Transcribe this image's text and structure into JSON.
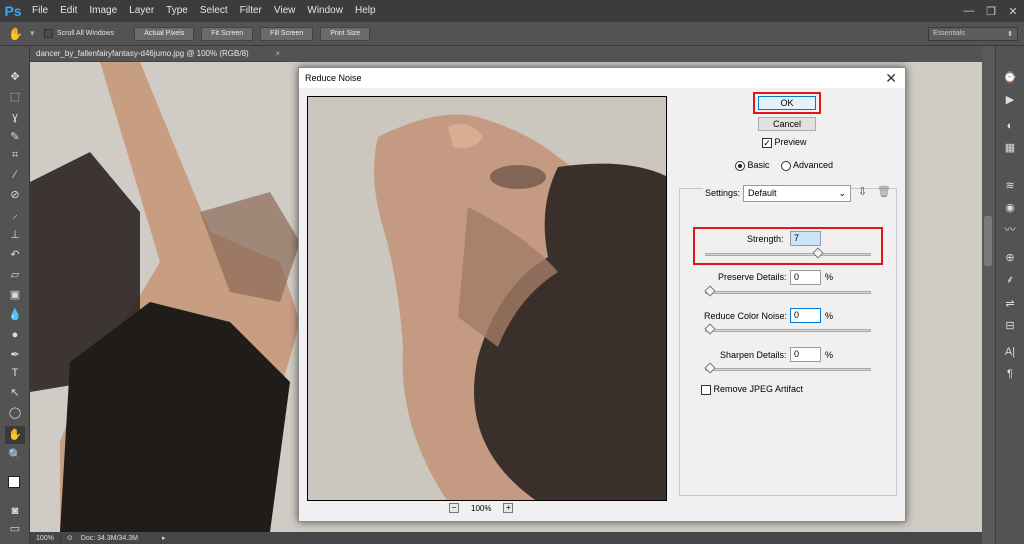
{
  "app": {
    "logo": "Ps"
  },
  "menu": [
    "File",
    "Edit",
    "Image",
    "Layer",
    "Type",
    "Select",
    "Filter",
    "View",
    "Window",
    "Help"
  ],
  "window_controls": {
    "minimize": "—",
    "restore": "❐",
    "close": "✕"
  },
  "options_bar": {
    "scroll_all_label": "Scroll All Windows",
    "buttons": [
      "Actual Pixels",
      "Fit Screen",
      "Fill Screen",
      "Print Size"
    ],
    "workspace": "Essentials"
  },
  "document": {
    "tab_title": "dancer_by_fallenfairyfantasy-d46jumo.jpg @ 100% (RGB/8)",
    "tab_close": "×"
  },
  "status_bar": {
    "zoom": "100%",
    "doc": "Doc: 34.3M/34.3M"
  },
  "dialog": {
    "title": "Reduce Noise",
    "close": "✕",
    "ok_label": "OK",
    "cancel_label": "Cancel",
    "preview_label": "Preview",
    "preview_checked": true,
    "mode_basic": "Basic",
    "mode_advanced": "Advanced",
    "selected_mode": "Basic",
    "settings_label": "Settings:",
    "settings_value": "Default",
    "zoom_minus": "−",
    "zoom_value": "100%",
    "zoom_plus": "+",
    "params": [
      {
        "label": "Strength:",
        "value": "7",
        "unit": "",
        "slider_fraction": 0.7
      },
      {
        "label": "Preserve Details:",
        "value": "0",
        "unit": "%",
        "slider_fraction": 0.0
      },
      {
        "label": "Reduce Color Noise:",
        "value": "0",
        "unit": "%",
        "slider_fraction": 0.0
      },
      {
        "label": "Sharpen Details:",
        "value": "0",
        "unit": "%",
        "slider_fraction": 0.0
      }
    ],
    "remove_jpeg_label": "Remove JPEG Artifact",
    "remove_jpeg_checked": false
  },
  "colors": {
    "highlight": "#e0161b",
    "ps_blue": "#31a8ff"
  }
}
